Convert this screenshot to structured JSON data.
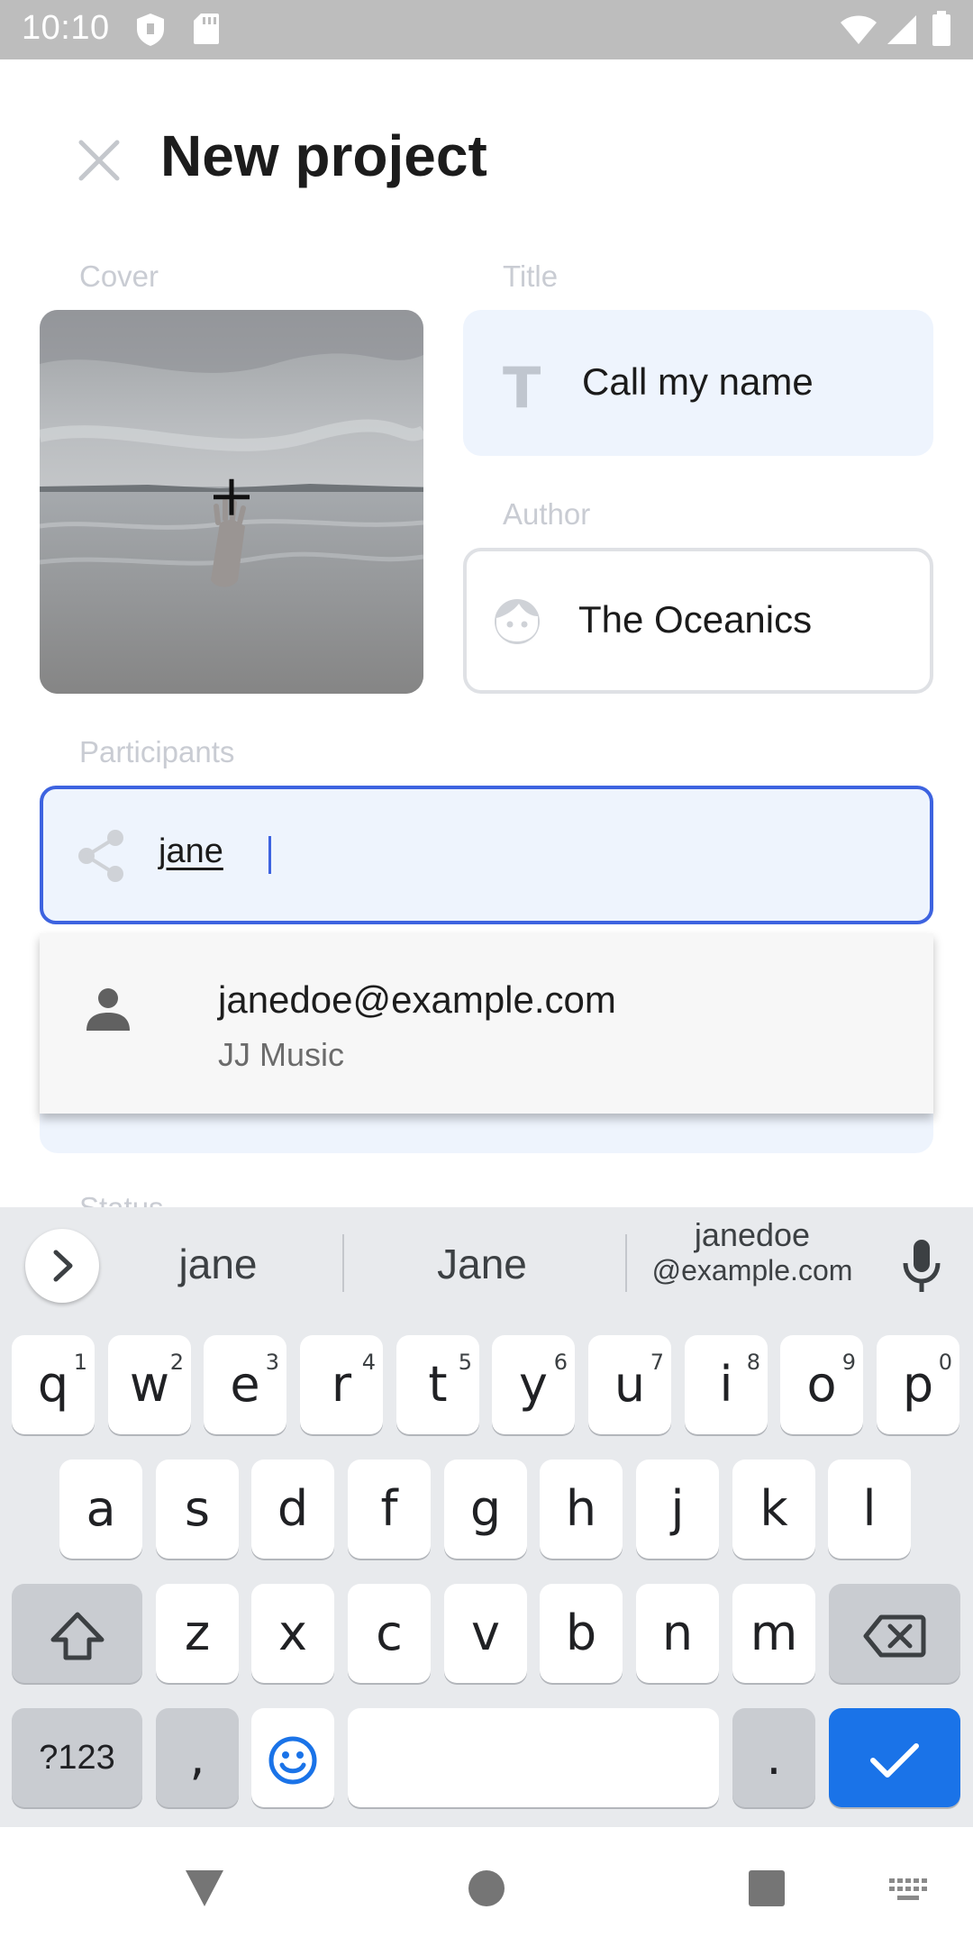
{
  "status_bar": {
    "time": "10:10",
    "left_icons": [
      "shield-icon",
      "sd-card-icon"
    ],
    "right_icons": [
      "wifi-icon",
      "signal-icon",
      "battery-icon"
    ]
  },
  "header": {
    "close_icon": "close-icon",
    "title": "New project"
  },
  "form": {
    "cover_label": "Cover",
    "title_label": "Title",
    "title_value": "Call my name",
    "author_label": "Author",
    "author_value": "The Oceanics",
    "participants_label": "Participants",
    "participants_value": "jane",
    "status_label": "Status"
  },
  "autocomplete": {
    "items": [
      {
        "icon": "person-icon",
        "email": "janedoe@example.com",
        "subtitle": "JJ Music"
      }
    ]
  },
  "keyboard": {
    "suggestions": [
      "jane",
      "Jane"
    ],
    "email_suggestion_line1": "janedoe",
    "email_suggestion_line2": "@example.com",
    "row1": [
      {
        "key": "q",
        "hint": "1"
      },
      {
        "key": "w",
        "hint": "2"
      },
      {
        "key": "e",
        "hint": "3"
      },
      {
        "key": "r",
        "hint": "4"
      },
      {
        "key": "t",
        "hint": "5"
      },
      {
        "key": "y",
        "hint": "6"
      },
      {
        "key": "u",
        "hint": "7"
      },
      {
        "key": "i",
        "hint": "8"
      },
      {
        "key": "o",
        "hint": "9"
      },
      {
        "key": "p",
        "hint": "0"
      }
    ],
    "row2": [
      "a",
      "s",
      "d",
      "f",
      "g",
      "h",
      "j",
      "k",
      "l"
    ],
    "row3": [
      "z",
      "x",
      "c",
      "v",
      "b",
      "n",
      "m"
    ],
    "symbols_label": "?123",
    "comma_label": ",",
    "period_label": ".",
    "accent_color": "#1a73e8"
  },
  "colors": {
    "focus_border": "#3d63e0",
    "field_fill": "#eef4fd"
  }
}
